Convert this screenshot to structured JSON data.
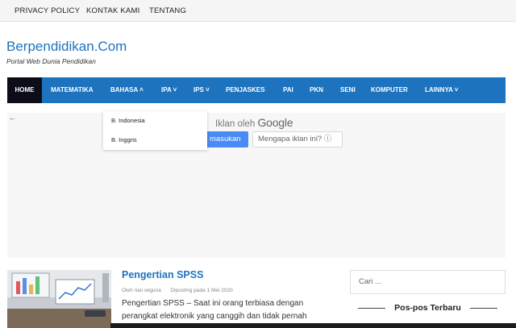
{
  "topnav": [
    "PRIVACY POLICY",
    "KONTAK KAMI",
    "TENTANG"
  ],
  "site": {
    "title": "Berpendidikan.Com",
    "description": "Portal Web Dunia Pendidikan"
  },
  "nav": {
    "items": [
      "HOME",
      "MATEMATIKA",
      "BAHASA ˄",
      "IPA ˅",
      "IPS ˅",
      "PENJASKES",
      "PAI",
      "PKN",
      "SENI",
      "KOMPUTER",
      "LAINNYA ˅"
    ],
    "dropdown": [
      "B. Indonesia",
      "B. Inggris"
    ]
  },
  "ad": {
    "back": "←",
    "by_prefix": "Iklan oleh",
    "brand": "Google",
    "button": "masukan",
    "why": "Mengapa iklan ini? ⓘ"
  },
  "post": {
    "title": "Pengertian SPSS",
    "author": "Oleh rian wiguna",
    "date": "Diposting pada 1 Mei 2020",
    "excerpt": "Pengertian SPSS – Saat ini orang terbiasa dengan perangkat elektronik yang canggih dan tidak pernah"
  },
  "sidebar": {
    "search_placeholder": "Cari ...",
    "widget_title": "Pos-pos Terbaru"
  },
  "colors": {
    "accent": "#1e73be",
    "home_bg": "#0d0d1a",
    "ad_button": "#4a8af4"
  }
}
